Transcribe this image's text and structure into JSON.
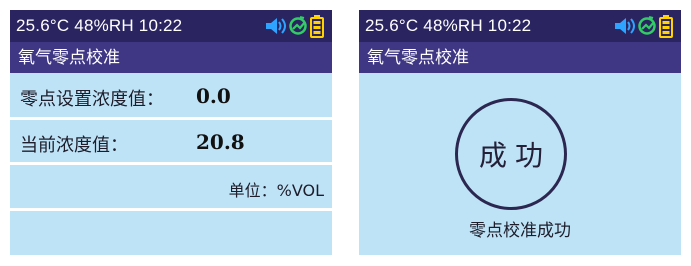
{
  "status_bar": {
    "text": "25.6°C 48%RH 10:22",
    "icons": [
      "speaker-icon",
      "pump-icon",
      "battery-icon"
    ],
    "colors": {
      "speaker": "#2ea3ff",
      "pump": "#33cc66",
      "battery": "#ffd200"
    }
  },
  "left_screen": {
    "title": "氧气零点校准",
    "rows": [
      {
        "label": "零点设置浓度值：",
        "value": "0.0"
      },
      {
        "label": "当前浓度值：",
        "value": "20.8"
      }
    ],
    "unit": "单位：%VOL"
  },
  "right_screen": {
    "title": "氧气零点校准",
    "circle_text": "成功",
    "message": "零点校准成功"
  },
  "colors": {
    "status_bg": "#2a2561",
    "title_bg": "#3f3784",
    "panel_bg": "#bfe3f6"
  }
}
